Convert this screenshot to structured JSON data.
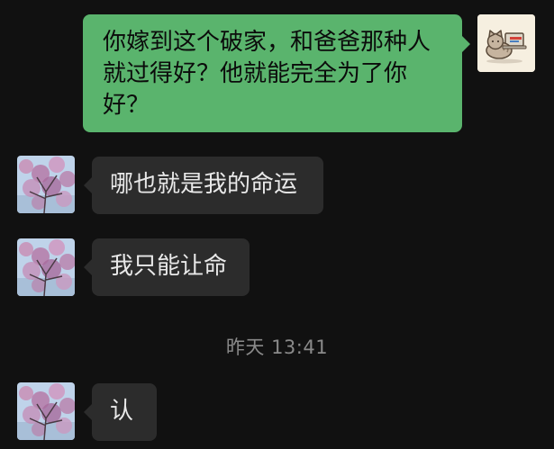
{
  "messages": [
    {
      "sender": "me",
      "text": "你嫁到这个破家，和爸爸那种人就过得好？他就能完全为了你好？",
      "avatar_icon": "cat-laptop-avatar-icon"
    },
    {
      "sender": "other",
      "text": "哪也就是我的命运",
      "avatar_icon": "blossom-tree-avatar-icon"
    },
    {
      "sender": "other",
      "text": "我只能让命",
      "avatar_icon": "blossom-tree-avatar-icon"
    },
    {
      "sender": "other",
      "text": "认",
      "avatar_icon": "blossom-tree-avatar-icon"
    }
  ],
  "timestamp": "昨天 13:41",
  "colors": {
    "background": "#111111",
    "outgoing_bubble": "#5ab46d",
    "incoming_bubble": "#2c2c2c",
    "incoming_text": "#e9e9e9",
    "outgoing_text": "#0b0b0b",
    "timestamp_text": "#8a8a8a"
  }
}
